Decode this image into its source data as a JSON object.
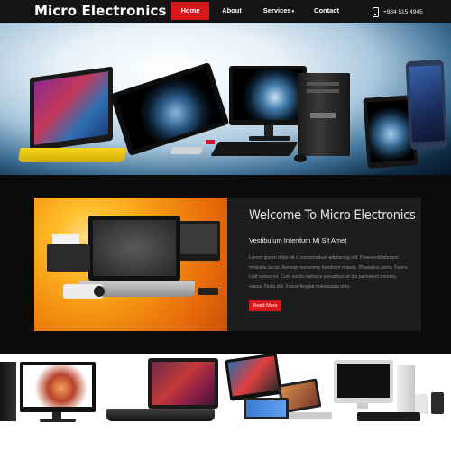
{
  "header": {
    "logo": "Micro Electronics",
    "nav": [
      {
        "label": "Home",
        "active": true
      },
      {
        "label": "About",
        "active": false
      },
      {
        "label": "Services",
        "active": false,
        "has_dropdown": true
      },
      {
        "label": "Contact",
        "active": false
      }
    ],
    "phone": "+984 515 4945",
    "phone_icon": "phone-icon"
  },
  "hero": {
    "background_accent": "#3e6f95",
    "devices": [
      "laptop",
      "all-in-one",
      "desktop-pc",
      "tablet",
      "tablet"
    ]
  },
  "welcome": {
    "title": "Welcome To Micro Electronics",
    "subtitle": "Vestibulum Interdum Mi Sit Amet",
    "body": "Lorem ipsum dolor sit t, consectetuer adipiscing elit. Praesentdbibulum molestie lacus. Aenean nonummy hendrerit mauris. Phasellus porta. Fusce cipit varius mi. Cum sociis natoque penatibus et dis parturient montes, nasus. Nulla dui. Fusce feugiat malesuada odio.",
    "button": "Read More"
  },
  "colors": {
    "brand_red": "#d8181b",
    "header_bg": "#141414",
    "section_bg": "#0b0b0b",
    "panel_bg": "#1d1d1d"
  }
}
